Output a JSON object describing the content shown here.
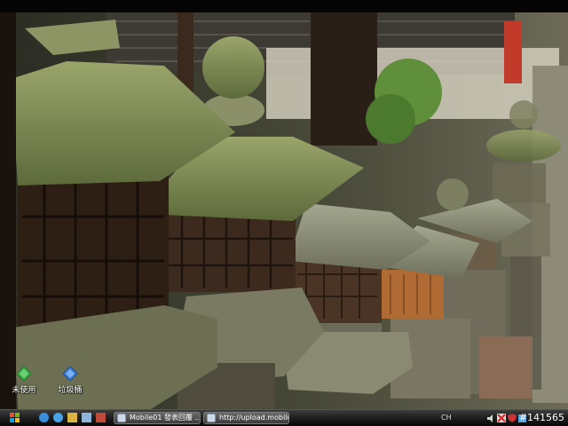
{
  "desktop": {
    "icons": [
      {
        "label": "未使用",
        "icon": "green-diamond-icon",
        "color": "#3bb54a"
      },
      {
        "label": "垃圾桶",
        "icon": "blue-diamond-recycle-icon",
        "color": "#3b7fd9"
      }
    ]
  },
  "taskbar": {
    "start_icon": "windows-logo-icon",
    "quick_launch": [
      "ie-icon",
      "media-icon",
      "folder-icon",
      "arrow-icon",
      "window-icon"
    ],
    "tasks": [
      {
        "label": "Mobile01 發表回覆 ...",
        "icon": "browser-window-icon"
      },
      {
        "label": "http://upload.mobile01...",
        "icon": "browser-window-icon"
      }
    ],
    "tray": {
      "ime": "CH",
      "icons": [
        "volume-icon",
        "network-icon",
        "security-icon",
        "gadget-icon"
      ]
    },
    "clock": "#141565"
  }
}
